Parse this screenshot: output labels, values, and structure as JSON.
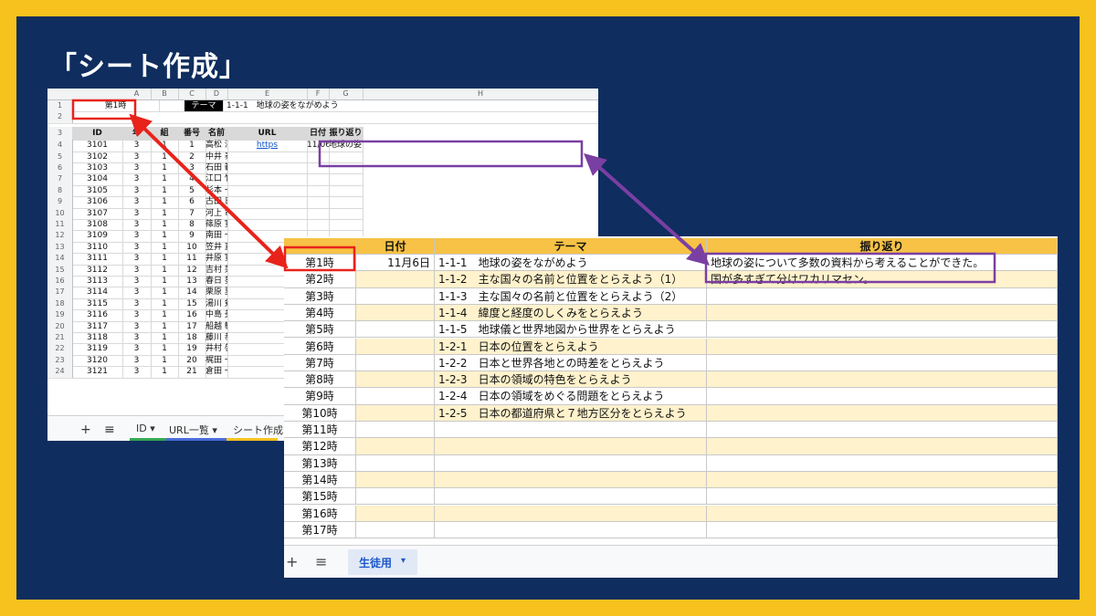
{
  "slide": {
    "title": "「シート作成」"
  },
  "sheet1": {
    "col_letters": [
      "A",
      "B",
      "C",
      "D",
      "E",
      "F",
      "G",
      "H"
    ],
    "row1": {
      "period": "第1時",
      "theme_label": "テーマ",
      "theme_value": "1-1-1　地球の姿をながめよう"
    },
    "headers": [
      "ID",
      "年",
      "組",
      "番号",
      "名前",
      "URL",
      "日付",
      "振り返り"
    ],
    "rows": [
      {
        "num": "4",
        "id": "3101",
        "year": "3",
        "cls": "1",
        "no": "1",
        "name": "高松 沙也香",
        "url": "https",
        "date": "11/06",
        "reflection": "地球の姿について多数の資料から考えることができた。"
      },
      {
        "num": "5",
        "id": "3102",
        "year": "3",
        "cls": "1",
        "no": "2",
        "name": "中井 泰賀",
        "url": "",
        "date": "",
        "reflection": ""
      },
      {
        "num": "6",
        "id": "3103",
        "year": "3",
        "cls": "1",
        "no": "3",
        "name": "石田 範久",
        "url": "",
        "date": "",
        "reflection": ""
      },
      {
        "num": "7",
        "id": "3104",
        "year": "3",
        "cls": "1",
        "no": "4",
        "name": "江口 竹男",
        "url": "",
        "date": "",
        "reflection": ""
      },
      {
        "num": "8",
        "id": "3105",
        "year": "3",
        "cls": "1",
        "no": "5",
        "name": "杉本 一夫",
        "url": "",
        "date": "",
        "reflection": ""
      },
      {
        "num": "9",
        "id": "3106",
        "year": "3",
        "cls": "1",
        "no": "6",
        "name": "古田 日菜",
        "url": "",
        "date": "",
        "reflection": ""
      },
      {
        "num": "10",
        "id": "3107",
        "year": "3",
        "cls": "1",
        "no": "7",
        "name": "河上 竜",
        "url": "",
        "date": "",
        "reflection": ""
      },
      {
        "num": "11",
        "id": "3108",
        "year": "3",
        "cls": "1",
        "no": "8",
        "name": "篠原 寛子",
        "url": "",
        "date": "",
        "reflection": ""
      },
      {
        "num": "12",
        "id": "3109",
        "year": "3",
        "cls": "1",
        "no": "9",
        "name": "南田 一博",
        "url": "",
        "date": "",
        "reflection": ""
      },
      {
        "num": "13",
        "id": "3110",
        "year": "3",
        "cls": "1",
        "no": "10",
        "name": "笠井 直季",
        "url": "",
        "date": "",
        "reflection": ""
      },
      {
        "num": "14",
        "id": "3111",
        "year": "3",
        "cls": "1",
        "no": "11",
        "name": "井原 寛子",
        "url": "",
        "date": "",
        "reflection": ""
      },
      {
        "num": "15",
        "id": "3112",
        "year": "3",
        "cls": "1",
        "no": "12",
        "name": "吉村 菜月",
        "url": "",
        "date": "",
        "reflection": ""
      },
      {
        "num": "16",
        "id": "3113",
        "year": "3",
        "cls": "1",
        "no": "13",
        "name": "春日 葵",
        "url": "",
        "date": "",
        "reflection": ""
      },
      {
        "num": "17",
        "id": "3114",
        "year": "3",
        "cls": "1",
        "no": "14",
        "name": "栗原 夏海",
        "url": "",
        "date": "",
        "reflection": ""
      },
      {
        "num": "18",
        "id": "3115",
        "year": "3",
        "cls": "1",
        "no": "15",
        "name": "湯川 剣丞",
        "url": "",
        "date": "",
        "reflection": ""
      },
      {
        "num": "19",
        "id": "3116",
        "year": "3",
        "cls": "1",
        "no": "16",
        "name": "中島 美奈",
        "url": "",
        "date": "",
        "reflection": ""
      },
      {
        "num": "20",
        "id": "3117",
        "year": "3",
        "cls": "1",
        "no": "17",
        "name": "船越 敏子",
        "url": "",
        "date": "",
        "reflection": ""
      },
      {
        "num": "21",
        "id": "3118",
        "year": "3",
        "cls": "1",
        "no": "18",
        "name": "藤川 恭一",
        "url": "",
        "date": "",
        "reflection": ""
      },
      {
        "num": "22",
        "id": "3119",
        "year": "3",
        "cls": "1",
        "no": "19",
        "name": "井村 啓一",
        "url": "",
        "date": "",
        "reflection": ""
      },
      {
        "num": "23",
        "id": "3120",
        "year": "3",
        "cls": "1",
        "no": "20",
        "name": "梶田 一輝",
        "url": "",
        "date": "",
        "reflection": ""
      },
      {
        "num": "24",
        "id": "3121",
        "year": "3",
        "cls": "1",
        "no": "21",
        "name": "倉田 一仁",
        "url": "",
        "date": "",
        "reflection": ""
      }
    ],
    "tabs": {
      "add": "+",
      "menu": "≡",
      "tab1": "ID",
      "tab2": "URL一覧",
      "tab3": "シート作成"
    }
  },
  "sheet2": {
    "headers": {
      "date": "日付",
      "theme": "テーマ",
      "reflection": "振り返り"
    },
    "rows": [
      {
        "period": "第1時",
        "date": "11月6日",
        "theme": "1-1-1　地球の姿をながめよう",
        "reflection": "地球の姿について多数の資料から考えることができた。"
      },
      {
        "period": "第2時",
        "date": "",
        "theme": "1-1-2　主な国々の名前と位置をとらえよう（1）",
        "reflection": "国が多すぎて分けワカリマセン。"
      },
      {
        "period": "第3時",
        "date": "",
        "theme": "1-1-3　主な国々の名前と位置をとらえよう（2）",
        "reflection": ""
      },
      {
        "period": "第4時",
        "date": "",
        "theme": "1-1-4　緯度と経度のしくみをとらえよう",
        "reflection": ""
      },
      {
        "period": "第5時",
        "date": "",
        "theme": "1-1-5　地球儀と世界地図から世界をとらえよう",
        "reflection": ""
      },
      {
        "period": "第6時",
        "date": "",
        "theme": "1-2-1　日本の位置をとらえよう",
        "reflection": ""
      },
      {
        "period": "第7時",
        "date": "",
        "theme": "1-2-2　日本と世界各地との時差をとらえよう",
        "reflection": ""
      },
      {
        "period": "第8時",
        "date": "",
        "theme": "1-2-3　日本の領域の特色をとらえよう",
        "reflection": ""
      },
      {
        "period": "第9時",
        "date": "",
        "theme": "1-2-4　日本の領域をめぐる問題をとらえよう",
        "reflection": ""
      },
      {
        "period": "第10時",
        "date": "",
        "theme": "1-2-5　日本の都道府県と７地方区分をとらえよう",
        "reflection": ""
      },
      {
        "period": "第11時",
        "date": "",
        "theme": "",
        "reflection": ""
      },
      {
        "period": "第12時",
        "date": "",
        "theme": "",
        "reflection": ""
      },
      {
        "period": "第13時",
        "date": "",
        "theme": "",
        "reflection": ""
      },
      {
        "period": "第14時",
        "date": "",
        "theme": "",
        "reflection": ""
      },
      {
        "period": "第15時",
        "date": "",
        "theme": "",
        "reflection": ""
      },
      {
        "period": "第16時",
        "date": "",
        "theme": "",
        "reflection": ""
      },
      {
        "period": "第17時",
        "date": "",
        "theme": "",
        "reflection": ""
      }
    ],
    "tabs": {
      "add": "+",
      "menu": "≡",
      "active_tab": "生徒用"
    }
  },
  "colors": {
    "frame": "#f7c21e",
    "panel": "#0f2d5e",
    "header_yellow": "#f7c245",
    "row_alt": "#fff2cc",
    "red_arrow": "#e8231b",
    "purple_arrow": "#7a3fa3"
  }
}
